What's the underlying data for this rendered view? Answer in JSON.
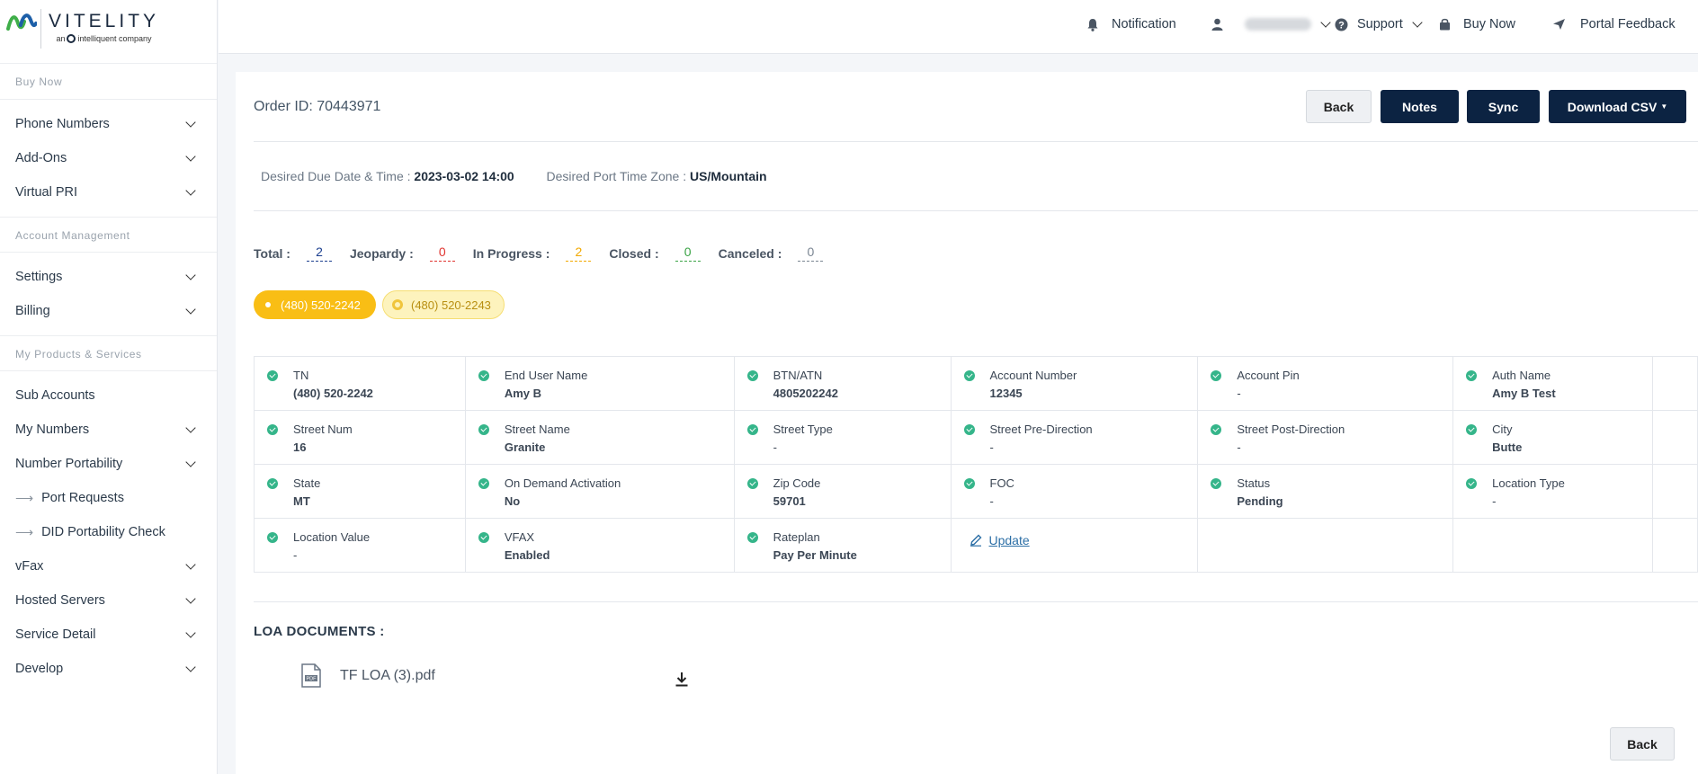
{
  "brand": {
    "name": "VITELITY",
    "tagline_prefix": "an",
    "tagline": "intelliquent company"
  },
  "sidebar": {
    "sections": [
      {
        "title": "Buy Now",
        "items": [
          {
            "label": "Phone Numbers",
            "expandable": true
          },
          {
            "label": "Add-Ons",
            "expandable": true
          },
          {
            "label": "Virtual PRI",
            "expandable": true
          }
        ]
      },
      {
        "title": "Account Management",
        "items": [
          {
            "label": "Settings",
            "expandable": true
          },
          {
            "label": "Billing",
            "expandable": true
          }
        ]
      },
      {
        "title": "My Products & Services",
        "items": [
          {
            "label": "Sub Accounts",
            "expandable": false
          },
          {
            "label": "My Numbers",
            "expandable": true
          },
          {
            "label": "Number Portability",
            "expandable": true
          },
          {
            "label": "Port Requests",
            "sub": true
          },
          {
            "label": "DID Portability Check",
            "sub": true
          },
          {
            "label": "vFax",
            "expandable": true
          },
          {
            "label": "Hosted Servers",
            "expandable": true
          },
          {
            "label": "Service Detail",
            "expandable": true
          },
          {
            "label": "Develop",
            "expandable": true
          }
        ]
      }
    ]
  },
  "topbar": {
    "notification": "Notification",
    "support": "Support",
    "buy_now": "Buy Now",
    "portal_feedback": "Portal Feedback"
  },
  "order": {
    "id_label": "Order ID: 70443971",
    "buttons": {
      "back": "Back",
      "notes": "Notes",
      "sync": "Sync",
      "download": "Download CSV"
    },
    "due_label": "Desired Due Date & Time :",
    "due_value": "2023-03-02 14:00",
    "tz_label": "Desired Port Time Zone :",
    "tz_value": "US/Mountain"
  },
  "counts": [
    {
      "label": "Total :",
      "value": "2",
      "color": "#1c3f8f"
    },
    {
      "label": "Jeopardy :",
      "value": "0",
      "color": "#e0332f"
    },
    {
      "label": "In Progress :",
      "value": "2",
      "color": "#f2a900"
    },
    {
      "label": "Closed :",
      "value": "0",
      "color": "#3aa345"
    },
    {
      "label": "Canceled :",
      "value": "0",
      "color": "#7a8592"
    }
  ],
  "numbers": {
    "active": "(480) 520-2242",
    "other": "(480) 520-2243"
  },
  "details": [
    [
      {
        "label": "TN",
        "value": "(480) 520-2242"
      },
      {
        "label": "End User Name",
        "value": "Amy B"
      },
      {
        "label": "BTN/ATN",
        "value": "4805202242"
      },
      {
        "label": "Account Number",
        "value": "12345"
      },
      {
        "label": "Account Pin",
        "value": "-"
      },
      {
        "label": "Auth Name",
        "value": "Amy B Test"
      }
    ],
    [
      {
        "label": "Street Num",
        "value": "16"
      },
      {
        "label": "Street Name",
        "value": "Granite"
      },
      {
        "label": "Street Type",
        "value": "-"
      },
      {
        "label": "Street Pre-Direction",
        "value": "-"
      },
      {
        "label": "Street Post-Direction",
        "value": "-"
      },
      {
        "label": "City",
        "value": "Butte"
      }
    ],
    [
      {
        "label": "State",
        "value": "MT"
      },
      {
        "label": "On Demand Activation",
        "value": "No"
      },
      {
        "label": "Zip Code",
        "value": "59701"
      },
      {
        "label": "FOC",
        "value": "-"
      },
      {
        "label": "Status",
        "value": "Pending"
      },
      {
        "label": "Location Type",
        "value": "-"
      }
    ],
    [
      {
        "label": "Location Value",
        "value": "-"
      },
      {
        "label": "VFAX",
        "value": "Enabled"
      },
      {
        "label": "Rateplan",
        "value": "Pay Per Minute"
      }
    ]
  ],
  "update_link": "Update",
  "loa": {
    "title": "LOA DOCUMENTS :",
    "file": "TF LOA (3).pdf"
  },
  "colors": {
    "navy": "#0c2342",
    "accent_yellow": "#f9be15",
    "check_green": "#35b58a"
  }
}
